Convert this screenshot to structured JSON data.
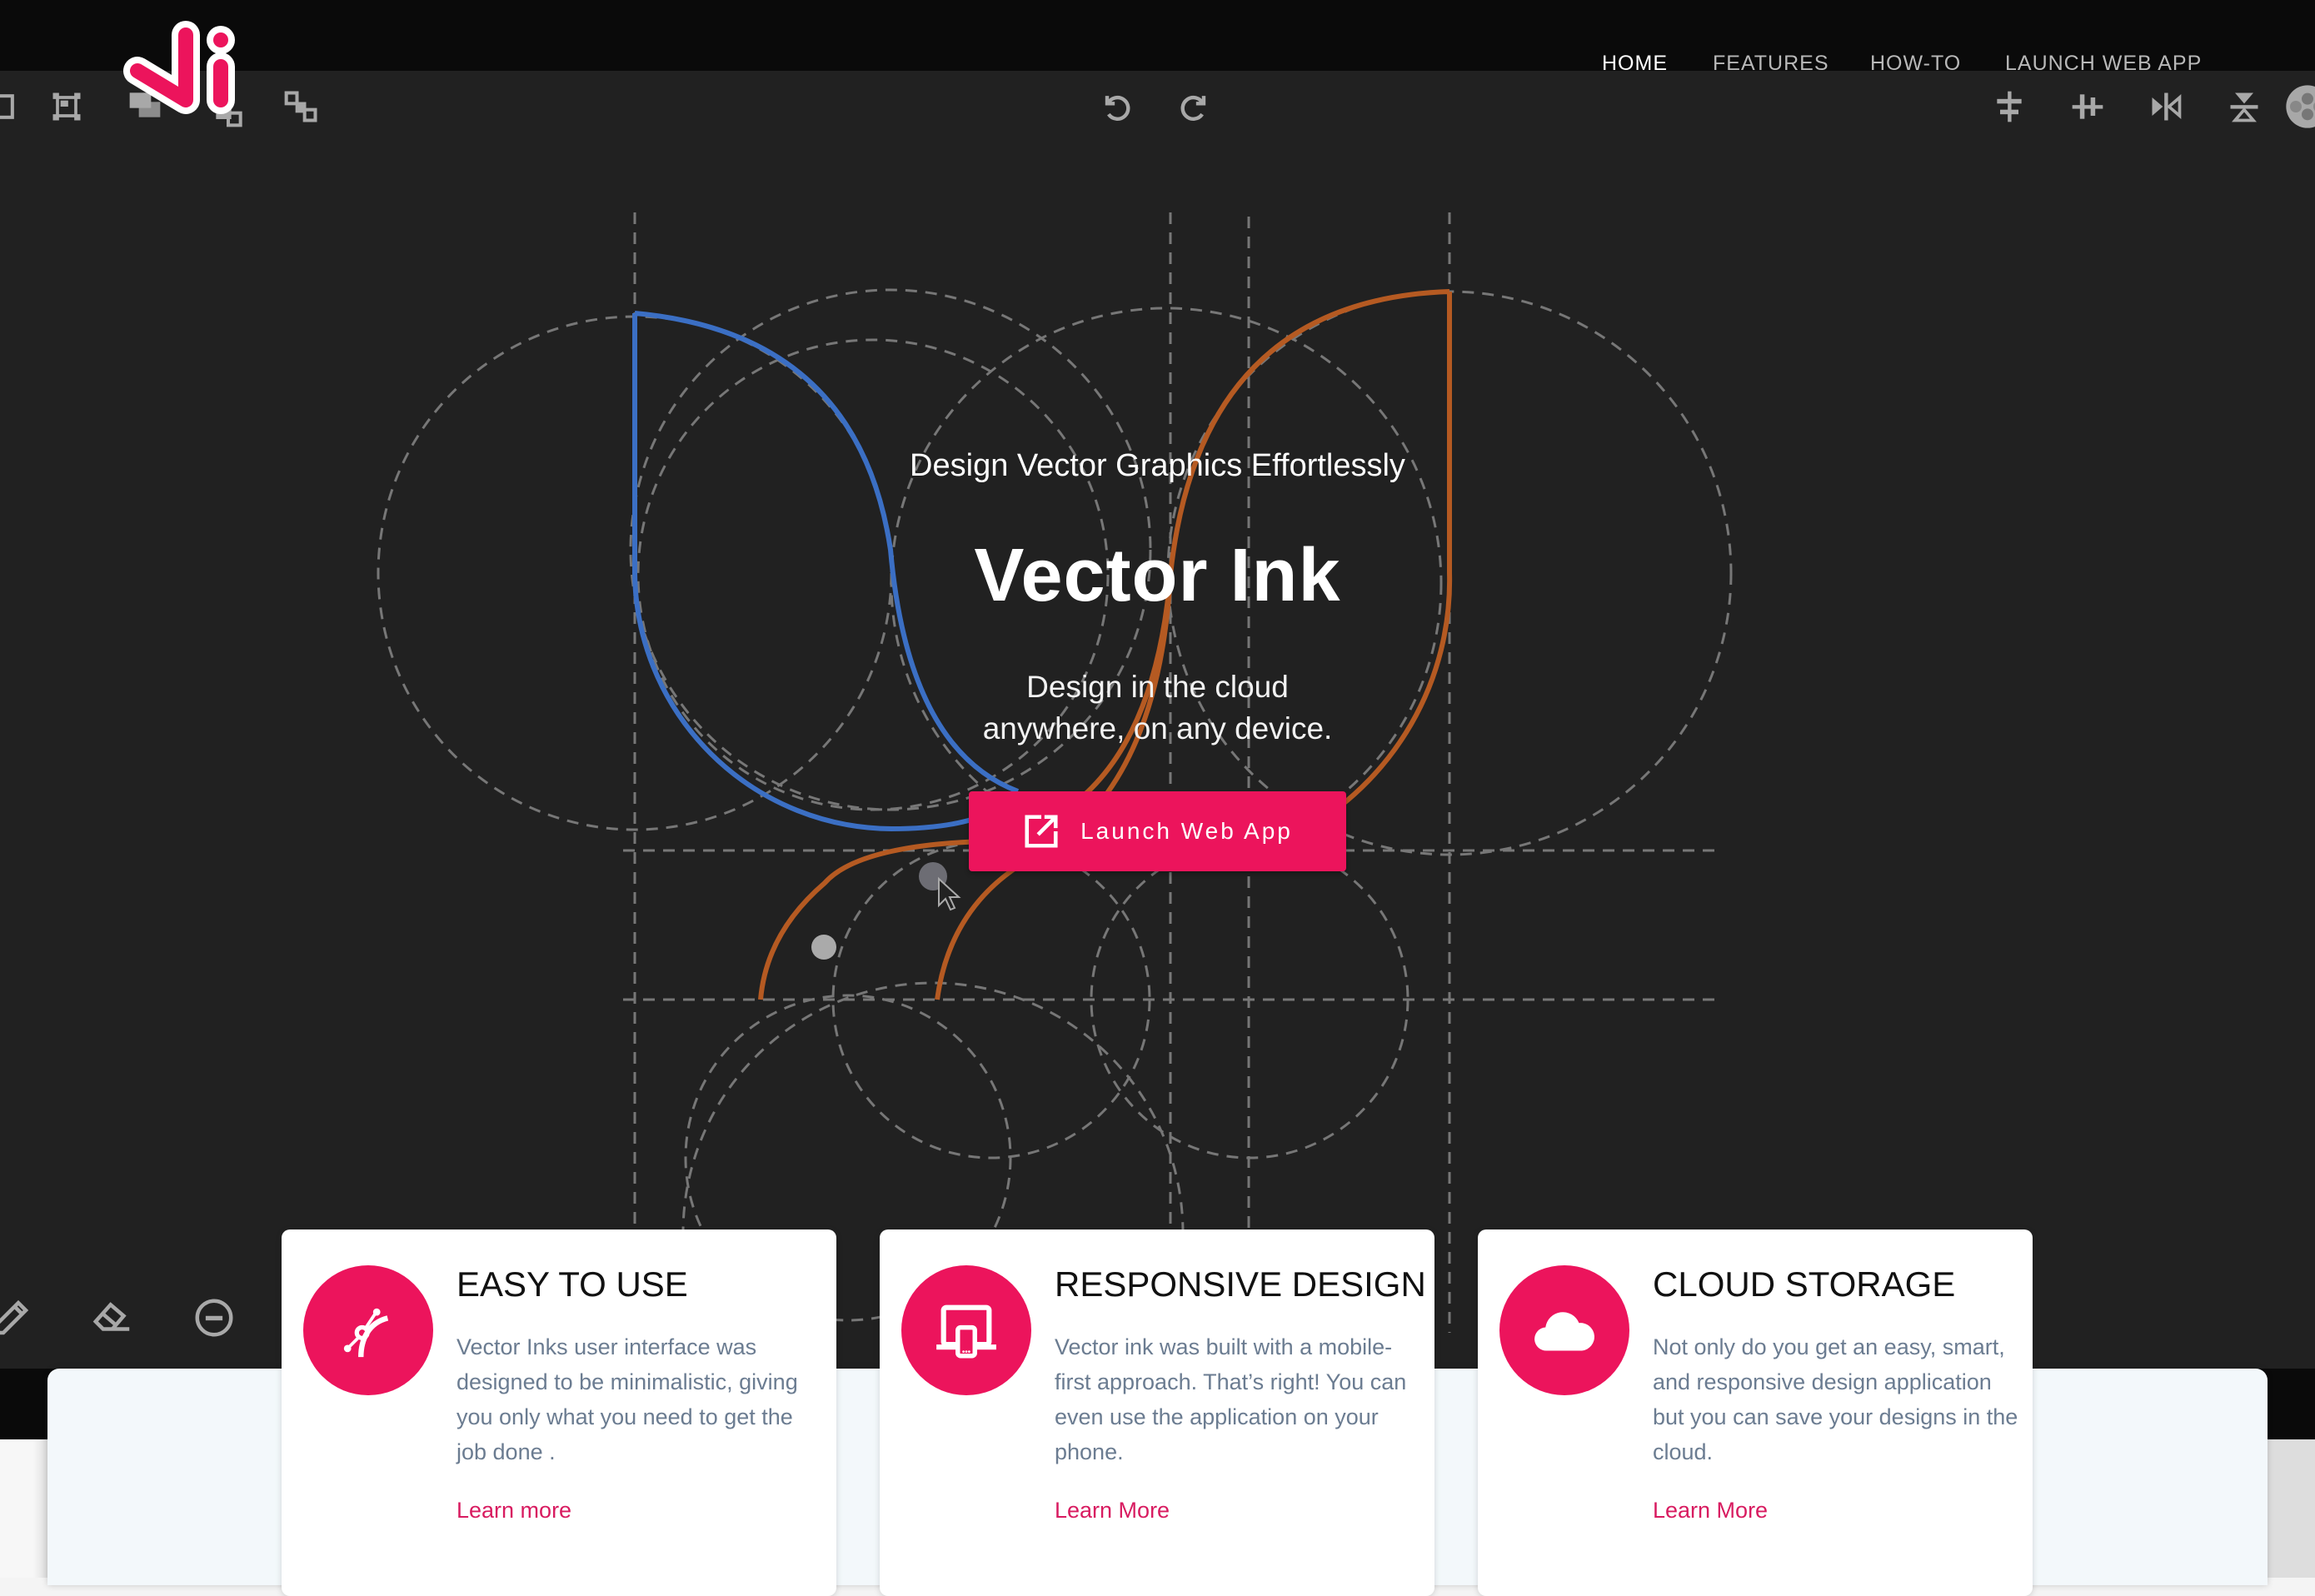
{
  "brand": {
    "logo_text": "Vi",
    "accent_color": "#ec145c"
  },
  "nav": {
    "items": [
      {
        "label": "HOME",
        "active": true
      },
      {
        "label": "FEATURES",
        "active": false
      },
      {
        "label": "HOW-TO",
        "active": false
      },
      {
        "label": "LAUNCH WEB APP",
        "active": false
      }
    ]
  },
  "toolbar_icons": {
    "top_left": [
      "group-icon",
      "resize-icon",
      "duplicate-icon",
      "arrange-icon",
      "ungroup-icon"
    ],
    "top_center": [
      "undo-icon",
      "redo-icon"
    ],
    "top_right": [
      "align-vertical-center-icon",
      "align-horizontal-center-icon",
      "flip-horizontal-icon",
      "flip-vertical-icon",
      "pattern-icon"
    ],
    "bottom_left": [
      "pencil-icon",
      "eraser-icon",
      "remove-icon"
    ]
  },
  "hero": {
    "subtitle": "Design Vector Graphics Effortlessly",
    "title": "Vector Ink",
    "description_line1": "Design in the cloud",
    "description_line2": "anywhere, on any device.",
    "cta_label": "Launch Web App",
    "cta_icon": "open-in-new-icon"
  },
  "features": [
    {
      "icon": "bezier-pen-icon",
      "title": "EASY TO USE",
      "body": "Vector Inks user interface was designed to be minimalistic, giving you only what you need to get the job done .",
      "link": "Learn more"
    },
    {
      "icon": "responsive-devices-icon",
      "title": "RESPONSIVE DESIGN",
      "body": "Vector ink was built with a mobile-first approach. That’s right! You can even use the application on your phone.",
      "link": "Learn More"
    },
    {
      "icon": "cloud-icon",
      "title": "CLOUD STORAGE",
      "body": "Not only do you get an easy, smart, and responsive design application but you can save your designs in the cloud.",
      "link": "Learn More"
    }
  ]
}
